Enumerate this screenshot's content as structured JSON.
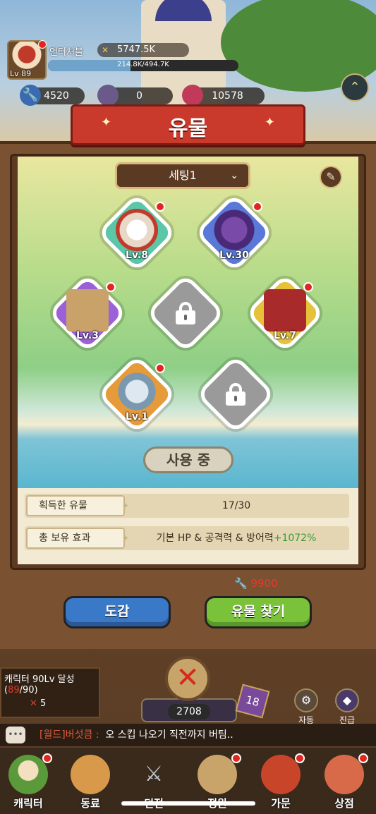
{
  "header": {
    "player_name": "언터처블",
    "power": "5747.5K",
    "level": "Lv 89",
    "xp_text": "214.8K/494.7K",
    "xp_fraction": 0.434
  },
  "currencies": {
    "wrench": "4520",
    "gem_blue": "0",
    "gem_red": "10578",
    "hidden_left": "1.0"
  },
  "modal": {
    "title": "유물",
    "setting_label": "세팅1",
    "in_use_label": "사용 중",
    "slots": [
      {
        "level": "Lv.8",
        "color": "#5bc6a8",
        "icon": "skull-mask-icon",
        "dot": true
      },
      {
        "level": "Lv.30",
        "color": "#5a78d8",
        "icon": "flag-icon",
        "dot": true
      },
      {
        "level": "Lv.3",
        "color": "#9a62d6",
        "icon": "box-icon",
        "dot": true
      },
      {
        "level": "",
        "color": "#9a9a9a",
        "icon": "lock-icon",
        "dot": false
      },
      {
        "level": "Lv.7",
        "color": "#e6c23a",
        "icon": "book-icon",
        "dot": true
      },
      {
        "level": "Lv.1",
        "color": "#e69a3a",
        "icon": "compass-icon",
        "dot": true
      },
      {
        "level": "",
        "color": "#9a9a9a",
        "icon": "lock-icon",
        "dot": false
      }
    ],
    "collected_label": "획득한 유물",
    "collected_value": "17/30",
    "effect_label": "총 보유 효과",
    "effect_value": "기본 HP & 공격력 & 방어력",
    "effect_bonus": "+1072%",
    "cost": "9900",
    "codex_button": "도감",
    "find_button": "유물 찾기"
  },
  "bottom": {
    "quest_title": "캐릭터 90Lv 달성",
    "quest_progress_cur": "89",
    "quest_progress_max": "/90)",
    "quest_progress_open": "(",
    "quest_reward": "5",
    "chest_count": "2708",
    "badge_count": "18",
    "auto_label": "자동",
    "promote_label": "진급",
    "chat_who": "[월드]버섯큼 :",
    "chat_msg": "오 스킵 나오기 직전까지 버팀.."
  },
  "nav": [
    {
      "label": "캐릭터",
      "icon": "mushroom-icon",
      "dot": true
    },
    {
      "label": "동료",
      "icon": "paw-icon",
      "dot": false
    },
    {
      "label": "던전",
      "icon": "crossed-swords-icon",
      "dot": false
    },
    {
      "label": "정원",
      "icon": "garden-icon",
      "dot": true
    },
    {
      "label": "가문",
      "icon": "skull-banner-icon",
      "dot": true
    },
    {
      "label": "상점",
      "icon": "shop-icon",
      "dot": true
    }
  ]
}
